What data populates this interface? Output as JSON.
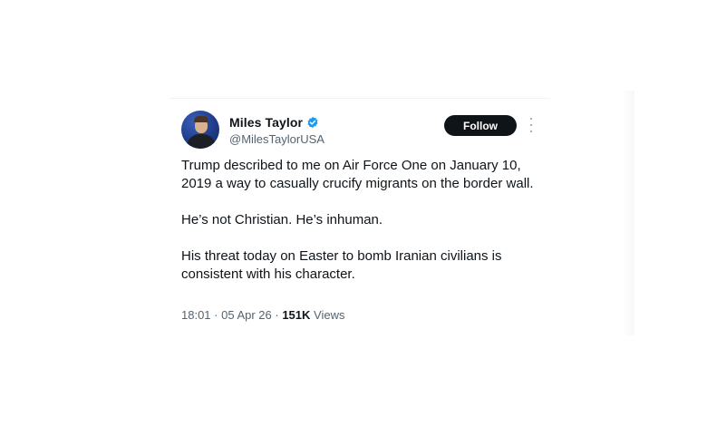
{
  "tweet": {
    "author": {
      "display_name": "Miles Taylor",
      "handle": "@MilesTaylorUSA",
      "verified_icon": "verified-badge-icon",
      "verified_color": "#1d9bf0"
    },
    "follow_label": "Follow",
    "paragraphs": [
      "Trump described to me on Air Force One on January 10, 2019 a way to casually crucify migrants on the border wall.",
      "He’s not Christian. He’s inhuman.",
      "His threat today on Easter to bomb Iranian civilians is consistent with his character."
    ],
    "meta": {
      "time": "18:01",
      "separator_1": " · ",
      "date": "05 Apr 26",
      "separator_2": " · ",
      "views_count": "151K",
      "views_label": " Views"
    }
  },
  "colors": {
    "text_primary": "#0f1419",
    "text_secondary": "#536471",
    "button_bg": "#0f1419",
    "button_text": "#ffffff"
  }
}
